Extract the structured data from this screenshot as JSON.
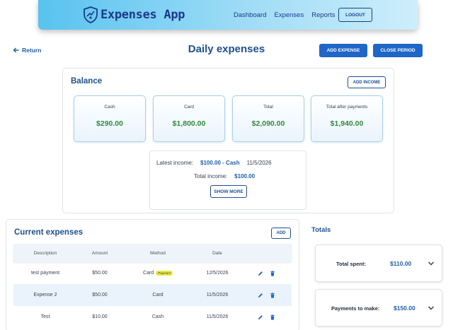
{
  "nav": {
    "brand": "Expenses App",
    "links": [
      "Dashboard",
      "Expenses",
      "Reports"
    ],
    "logout": "LOGOUT"
  },
  "header": {
    "return_label": "Return",
    "title": "Daily expenses",
    "add_expense": "ADD EXPENSE",
    "close_period": "CLOSE PERIOD"
  },
  "balance": {
    "title": "Balance",
    "add_income": "ADD INCOME",
    "stats": [
      {
        "label": "Cash",
        "value": "$290.00"
      },
      {
        "label": "Card",
        "value": "$1,800.00"
      },
      {
        "label": "Total",
        "value": "$2,090.00"
      },
      {
        "label": "Total after payments",
        "value": "$1,940.00"
      }
    ],
    "latest_income_label": "Latest income:",
    "latest_income_value": "$100.00 - Cash",
    "latest_income_date": "11/5/2026",
    "total_income_label": "Total income:",
    "total_income_value": "$100.00",
    "show_more": "SHOW MORE"
  },
  "expenses": {
    "title": "Current expenses",
    "add_label": "ADD",
    "columns": [
      "Description",
      "Amount",
      "Method",
      "Date"
    ],
    "rows": [
      {
        "description": "test payment",
        "amount": "$50.00",
        "method": "Card",
        "badge": "Payment",
        "date": "12/5/2026"
      },
      {
        "description": "Expense 2",
        "amount": "$50.00",
        "method": "Card",
        "badge": "",
        "date": "11/5/2026"
      },
      {
        "description": "Test",
        "amount": "$10.00",
        "method": "Cash",
        "badge": "",
        "date": "11/5/2026"
      }
    ]
  },
  "totals": {
    "title": "Totals",
    "spent_label": "Total spent:",
    "spent_value": "$110.00",
    "payments_label": "Payments to make:",
    "payments_value": "$150.00"
  },
  "colors": {
    "primary": "#1e66c8",
    "accent_text": "#1e5fa8",
    "positive": "#2e8b3d",
    "badge": "#e5e94a"
  }
}
